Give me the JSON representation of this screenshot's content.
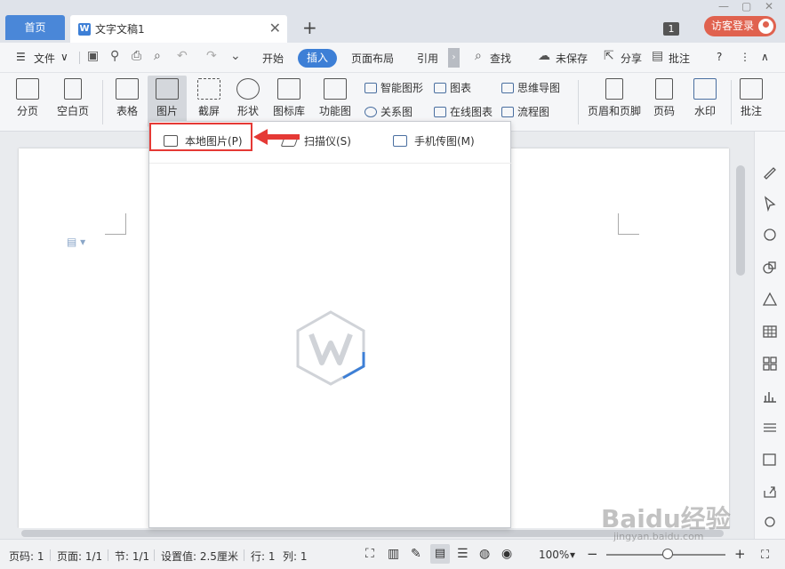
{
  "tabs": {
    "home": "首页",
    "doc_title": "文字文稿1",
    "add": "+",
    "close": "✕"
  },
  "window": {
    "badge": "1",
    "login": "访客登录"
  },
  "menubar": {
    "file": "文件",
    "start": "开始",
    "insert": "插入",
    "layout": "页面布局",
    "reference": "引用",
    "find": "查找",
    "unsaved": "未保存",
    "share": "分享",
    "annotate": "批注",
    "help": "?"
  },
  "ribbon": {
    "page_break": "分页",
    "blank_page": "空白页",
    "table": "表格",
    "picture": "图片",
    "screenshot": "截屏",
    "shape": "形状",
    "icon_lib": "图标库",
    "function_chart": "功能图",
    "smart_shape": "智能图形",
    "chart": "图表",
    "mindmap": "思维导图",
    "relation": "关系图",
    "online_chart": "在线图表",
    "flowchart": "流程图",
    "header_footer": "页眉和页脚",
    "page_number": "页码",
    "watermark": "水印",
    "comment": "批注"
  },
  "dropdown": {
    "local_picture": "本地图片(P)",
    "scanner": "扫描仪(S)",
    "phone_picture": "手机传图(M)"
  },
  "statusbar": {
    "page_no": "页码: 1",
    "pages": "页面: 1/1",
    "section": "节: 1/1",
    "setting": "设置值: 2.5厘米",
    "row": "行: 1",
    "col": "列: 1",
    "zoom": "100%",
    "minus": "−",
    "plus": "+"
  },
  "watermark": {
    "text": "Baidu经验",
    "sub": "jingyan.baidu.com"
  },
  "colors": {
    "accent": "#3d7fd6",
    "highlight": "#e53935",
    "login": "#e0624f"
  }
}
